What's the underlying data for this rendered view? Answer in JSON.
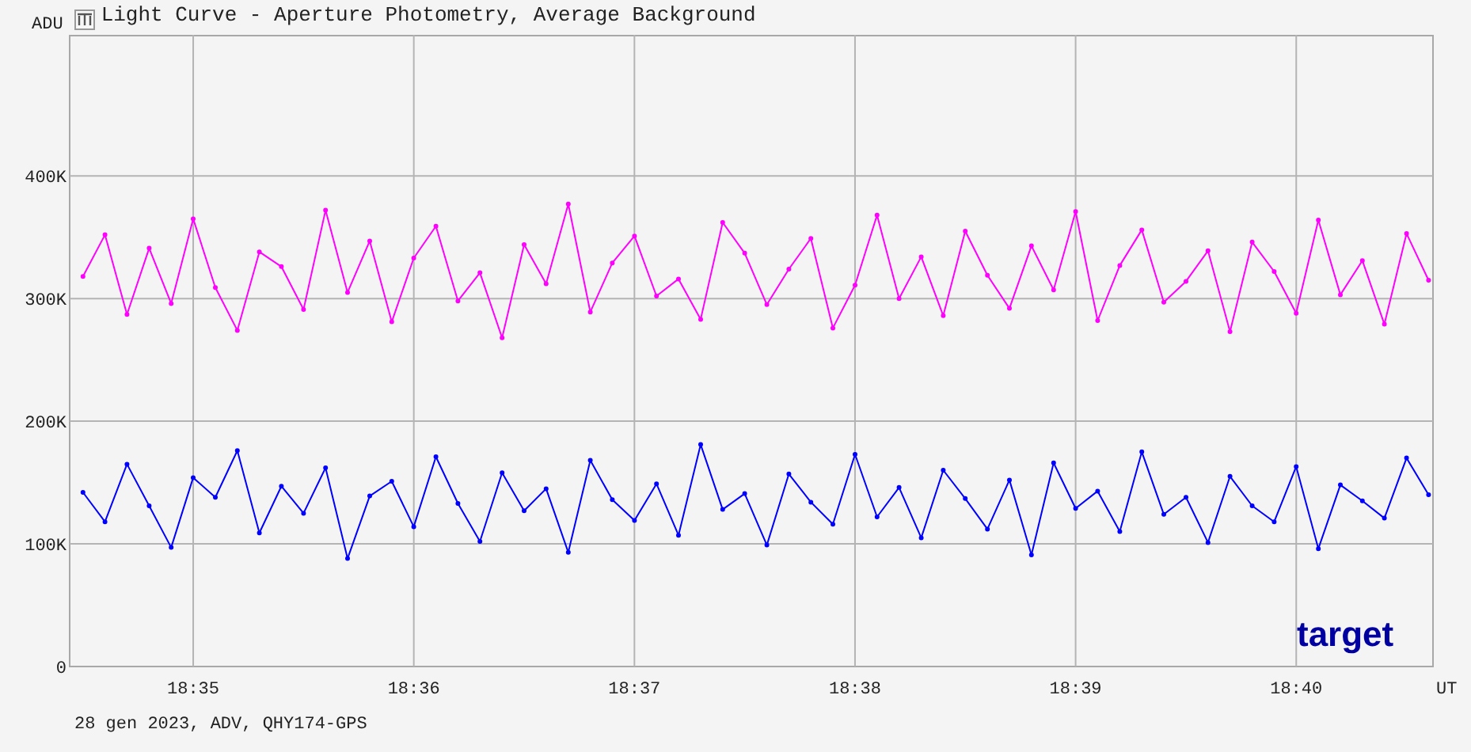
{
  "window": {
    "title": "Light Curve - Aperture Photometry, Average Background"
  },
  "plot": {
    "chart_data": {
      "type": "line",
      "ylabel": "ADU",
      "xlabel": "UT",
      "yticks": [
        {
          "value": 400000,
          "label": "400K"
        },
        {
          "value": 300000,
          "label": "300K"
        },
        {
          "value": 200000,
          "label": "200K"
        },
        {
          "value": 100000,
          "label": "100K"
        },
        {
          "value": 0,
          "label": "0"
        }
      ],
      "ylim": [
        0,
        515000
      ],
      "grid": true,
      "categories": [
        null,
        null,
        null,
        null,
        null,
        "18:35",
        null,
        null,
        null,
        null,
        null,
        null,
        null,
        null,
        null,
        "18:36",
        null,
        null,
        null,
        null,
        null,
        null,
        null,
        null,
        null,
        "18:37",
        null,
        null,
        null,
        null,
        null,
        null,
        null,
        null,
        null,
        "18:38",
        null,
        null,
        null,
        null,
        null,
        null,
        null,
        null,
        null,
        "18:39",
        null,
        null,
        null,
        null,
        null,
        null,
        null,
        null,
        null,
        "18:40",
        null,
        null,
        null,
        null,
        null,
        null
      ],
      "series": [
        {
          "color": "#ff00ff",
          "values": [
            318000,
            352000,
            287000,
            341000,
            296000,
            365000,
            309000,
            274000,
            338000,
            326000,
            291000,
            372000,
            305000,
            347000,
            281000,
            333000,
            359000,
            298000,
            321000,
            268000,
            344000,
            312000,
            377000,
            289000,
            329000,
            351000,
            302000,
            316000,
            283000,
            362000,
            337000,
            295000,
            324000,
            349000,
            276000,
            311000,
            368000,
            300000,
            334000,
            286000,
            355000,
            319000,
            292000,
            343000,
            307000,
            371000,
            282000,
            327000,
            356000,
            297000,
            314000,
            339000,
            273000,
            346000,
            322000,
            288000,
            364000,
            303000,
            331000,
            279000,
            353000,
            315000
          ]
        },
        {
          "color": "#0000ff",
          "values": [
            142000,
            118000,
            165000,
            131000,
            97000,
            154000,
            138000,
            176000,
            109000,
            147000,
            125000,
            162000,
            88000,
            139000,
            151000,
            114000,
            171000,
            133000,
            102000,
            158000,
            127000,
            145000,
            93000,
            168000,
            136000,
            119000,
            149000,
            107000,
            181000,
            128000,
            141000,
            99000,
            157000,
            134000,
            116000,
            173000,
            122000,
            146000,
            105000,
            160000,
            137000,
            112000,
            152000,
            91000,
            166000,
            129000,
            143000,
            110000,
            175000,
            124000,
            138000,
            101000,
            155000,
            131000,
            118000,
            163000,
            96000,
            148000,
            135000,
            121000,
            170000,
            140000
          ]
        }
      ]
    },
    "legend": "target"
  },
  "status_bar": "28 gen 2023, ADV, QHY174-GPS"
}
